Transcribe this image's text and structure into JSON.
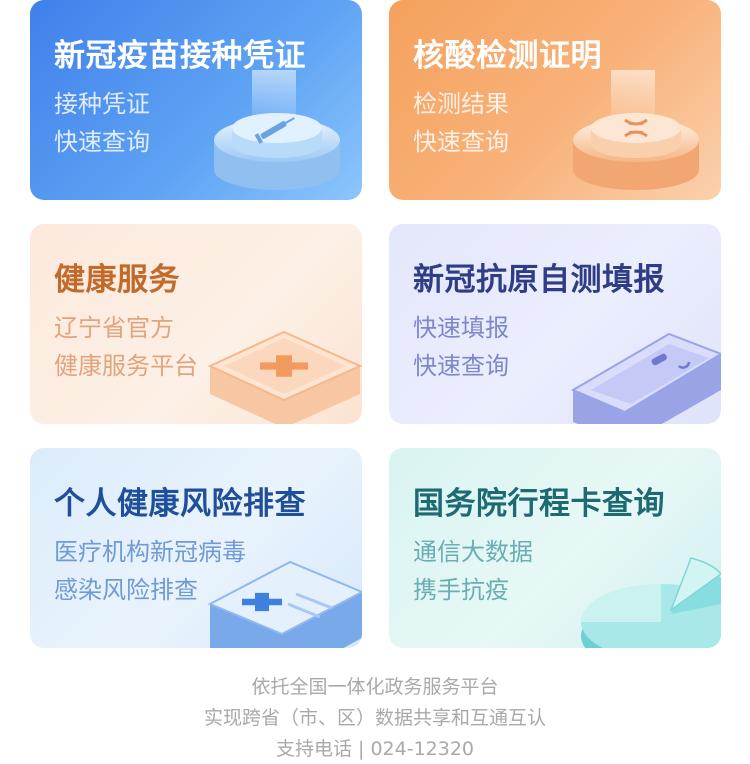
{
  "cards": [
    {
      "title": "新冠疫苗接种凭证",
      "line1": "接种凭证",
      "line2": "快速查询",
      "icon": "vaccine-syringe-icon"
    },
    {
      "title": "核酸检测证明",
      "line1": "检测结果",
      "line2": "快速查询",
      "icon": "nucleic-acid-test-icon"
    },
    {
      "title": "健康服务",
      "line1": "辽宁省官方",
      "line2": "健康服务平台",
      "icon": "medical-cross-box-icon"
    },
    {
      "title": "新冠抗原自测填报",
      "line1": "快速填报",
      "line2": "快速查询",
      "icon": "antigen-test-card-icon"
    },
    {
      "title": "个人健康风险排查",
      "line1": "医疗机构新冠病毒",
      "line2": "感染风险排查",
      "icon": "medical-report-icon"
    },
    {
      "title": "国务院行程卡查询",
      "line1": "通信大数据",
      "line2": "携手抗疫",
      "icon": "pie-chart-icon"
    }
  ],
  "footer": {
    "line1": "依托全国一体化政务服务平台",
    "line2": "实现跨省（市、区）数据共享和互通互认",
    "line3": "支持电话 | 024-12320"
  }
}
